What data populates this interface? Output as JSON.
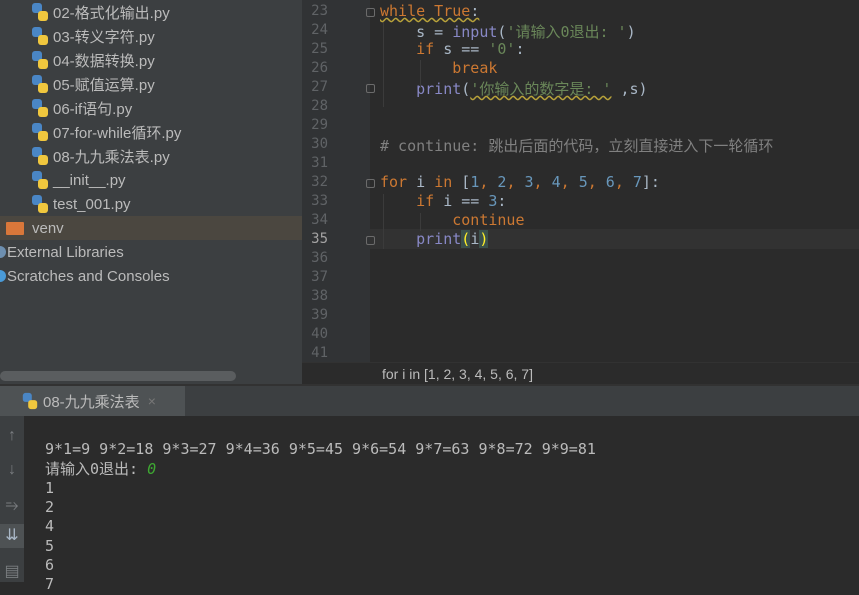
{
  "project_tree": {
    "files": [
      "02-格式化输出.py",
      "03-转义字符.py",
      "04-数据转换.py",
      "05-赋值运算.py",
      "06-if语句.py",
      "07-for-while循环.py",
      "08-九九乘法表.py",
      "__init__.py",
      "test_001.py"
    ],
    "venv": "venv",
    "external_libraries": "External Libraries",
    "scratches": "Scratches and Consoles"
  },
  "editor": {
    "line_numbers": [
      "23",
      "24",
      "25",
      "26",
      "27",
      "28",
      "29",
      "30",
      "31",
      "32",
      "33",
      "34",
      "35",
      "36",
      "37",
      "38",
      "39",
      "40",
      "41"
    ],
    "current_line": "35",
    "lines": [
      [
        {
          "t": "while True",
          "c": "kw wavy"
        },
        {
          "t": ":",
          "c": "op wavy"
        }
      ],
      [
        {
          "t": "    s = ",
          "c": "op"
        },
        {
          "t": "input",
          "c": "bi"
        },
        {
          "t": "(",
          "c": "op"
        },
        {
          "t": "'请输入0退出: '",
          "c": "str"
        },
        {
          "t": ")",
          "c": "op"
        }
      ],
      [
        {
          "t": "    ",
          "c": "op"
        },
        {
          "t": "if",
          "c": "kw"
        },
        {
          "t": " s == ",
          "c": "op"
        },
        {
          "t": "'0'",
          "c": "str"
        },
        {
          "t": ":",
          "c": "op"
        }
      ],
      [
        {
          "t": "        ",
          "c": "op"
        },
        {
          "t": "break",
          "c": "kw"
        }
      ],
      [
        {
          "t": "    ",
          "c": "op"
        },
        {
          "t": "print",
          "c": "bi"
        },
        {
          "t": "(",
          "c": "op"
        },
        {
          "t": "'你输入的数字是: '",
          "c": "str wavy"
        },
        {
          "t": " ,s)",
          "c": "op"
        }
      ],
      [],
      [],
      [
        {
          "t": "# continue: 跳出后面的代码，立刻直接进入下一轮循环",
          "c": "cm"
        }
      ],
      [],
      [
        {
          "t": "for",
          "c": "kw"
        },
        {
          "t": " i ",
          "c": "op"
        },
        {
          "t": "in",
          "c": "kw"
        },
        {
          "t": " [",
          "c": "op"
        },
        {
          "t": "1",
          "c": "num"
        },
        {
          "t": ", ",
          "c": "kw"
        },
        {
          "t": "2",
          "c": "num"
        },
        {
          "t": ", ",
          "c": "kw"
        },
        {
          "t": "3",
          "c": "num"
        },
        {
          "t": ", ",
          "c": "kw"
        },
        {
          "t": "4",
          "c": "num"
        },
        {
          "t": ", ",
          "c": "kw"
        },
        {
          "t": "5",
          "c": "num"
        },
        {
          "t": ", ",
          "c": "kw"
        },
        {
          "t": "6",
          "c": "num"
        },
        {
          "t": ", ",
          "c": "kw"
        },
        {
          "t": "7",
          "c": "num"
        },
        {
          "t": "]:",
          "c": "op"
        }
      ],
      [
        {
          "t": "    ",
          "c": "op"
        },
        {
          "t": "if",
          "c": "kw"
        },
        {
          "t": " i == ",
          "c": "op"
        },
        {
          "t": "3",
          "c": "num"
        },
        {
          "t": ":",
          "c": "op"
        }
      ],
      [
        {
          "t": "        ",
          "c": "op"
        },
        {
          "t": "continue",
          "c": "kw"
        }
      ],
      [
        {
          "t": "    ",
          "c": "op"
        },
        {
          "t": "print",
          "c": "bi"
        },
        {
          "t": "(",
          "c": "brace"
        },
        {
          "t": "i",
          "c": "op"
        },
        {
          "t": ")",
          "c": "brace"
        }
      ],
      [],
      [],
      [],
      [],
      [],
      []
    ],
    "breadcrumb": "for i in [1, 2, 3, 4, 5, 6, 7]"
  },
  "run_panel": {
    "tab_label": "08-九九乘法表",
    "close_icon": "×",
    "output_lines": [
      "9*1=9 9*2=18 9*3=27 9*4=36 9*5=45 9*6=54 9*7=63 9*8=72 9*9=81"
    ],
    "prompt": "请输入0退出: ",
    "user_input": "0",
    "result_lines": [
      "1",
      "2",
      "4",
      "5",
      "6",
      "7"
    ],
    "toolbar_icons": [
      "arrow-up-icon",
      "arrow-down-icon",
      "soft-wrap-icon",
      "scroll-to-end-icon",
      "print-icon"
    ]
  }
}
